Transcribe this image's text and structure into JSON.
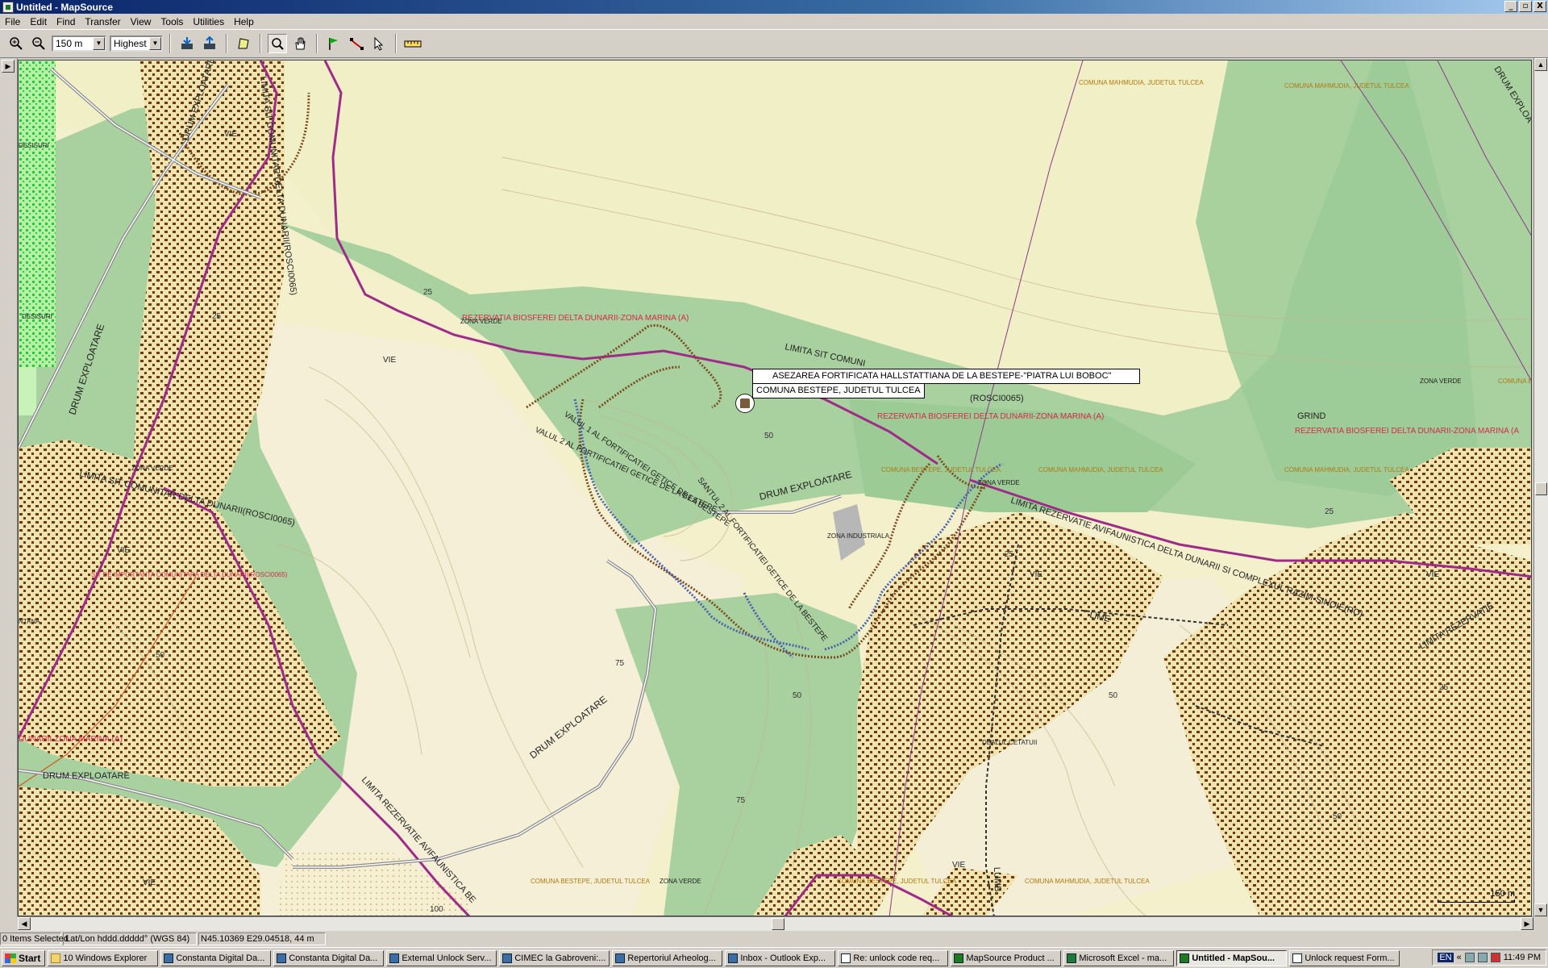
{
  "window": {
    "title": "Untitled - MapSource",
    "buttons": [
      "_",
      "▫",
      "X"
    ]
  },
  "menu": [
    "File",
    "Edit",
    "Find",
    "Transfer",
    "View",
    "Tools",
    "Utilities",
    "Help"
  ],
  "toolbar": {
    "zoom_value": "150 m",
    "detail_value": "Highest"
  },
  "map": {
    "tooltip_title": "ASEZAREA FORTIFICATA HALLSTATTIANA DE LA BESTEPE-\"PIATRA LUI BOBOC\"",
    "tooltip_subtitle": "COMUNA BESTEPE, JUDETUL TULCEA",
    "labels": {
      "rez1": "REZERVATIA BIOSFEREI DELTA DUNARII-ZONA MARINA (A)",
      "rez2": "REZERVATIA BIOSFEREI DELTA DUNARII-ZONA MARINA (A)",
      "rez3": "REZERVATIA BIOSFEREI DELTA DUNARII-ZONA MARINA (A",
      "rez4": "DUNARII-ZONA MARINA (A)",
      "mahm1": "COMUNA MAHMUDIA, JUDETUL TULCEA",
      "mahm2": "COMUNA MAHMUDIA, JUDETUL TULCEA",
      "mahm3": "COMUNA MAHMUDIA, JUDETUL TULCEA",
      "mahm4": "COMUNA MAHMUDIA, JUDETUL TULCEA",
      "mahm5": "COMUNA MAHMUDIA, JUDETUL TULCEA",
      "bestepe1": "COMUNA BESTEPE, JUDETUL TULCEA",
      "bestepe2": "COMUNA BESTEPE, JUDETUL TULCEA",
      "bestepe3": "COMUNA BESTEPE, JUDETUL TULCEA",
      "zona_be": "COMUNA BE",
      "drum1": "DRUM EXPLOATARE",
      "drum2": "DRUM EXPLOATARE",
      "drum3": "DRUM EXPLOATARE",
      "drum4": "DRUM EXPLOATARE",
      "drum5": "DRUM EXPLOA",
      "drum6": "DRUM EXPLOATARE",
      "zv1": "ZONA VERDE",
      "zv2": "ZONA VERDE",
      "zv3": "ZONA VERDE",
      "zv4": "ZONA VERDE",
      "zv5": "ZONA VERDE",
      "zi": "ZONA INDUSTRIALA",
      "grind": "GRIND",
      "vie1": "VIE",
      "vie2": "VIE",
      "vie3": "VIE",
      "vie4": "VIE",
      "vie5": "VIE",
      "vie6": "VIE",
      "vie7": "VIE",
      "desisuri1": "DESISURI",
      "desisuri2": "DESISURI",
      "ntana": "NTANA",
      "limita_sit1": "LIMITA SIT COMUNITAR DELTA DUNARII(ROSCI0065)",
      "limita_sit2": "LIMITA SIT COMUNITAR DELTA DUNARII(ROSCI0065)",
      "limita_sit3": "LIMITA SIT COMUNI",
      "rosci": "(ROSCI0065)",
      "situl": "SIT DE IMPORTANTA COMUNITARA DELTA DUNARII(ROSCI0065)",
      "valul1": "VALUL 2 AL FORTIFICATIEI GETICE DE LA BESTEPE",
      "valul2": "VALUL 1 AL FORTIFICATIEI GETICE DE LA BESTEPE",
      "santul": "SANTUL 2 AL FORTIFICATIEI GETICE DE LA BESTEPE",
      "limita_rez1": "LIMITA REZERVATIE AVIFAUNISTICA DELTA DUNARII SI COMPLEXUL RAZIM-SINOIE(RO)",
      "limita_rez2": "LIMITA REZERVATIE AVIFAUNISTICA BE",
      "limita_rez3": "LIMITA REZERVATIE",
      "dealul": "DEALUL CETATUII",
      "lime": "LIME",
      "lumb": "LUMB",
      "c25a": "25",
      "c25b": "25",
      "c25c": "25",
      "c25d": "25",
      "c25e": "25",
      "c50a": "50",
      "c50b": "50",
      "c50c": "50",
      "c50d": "50",
      "c50e": "50",
      "c75a": "75",
      "c75b": "75",
      "c100": "100"
    },
    "scale": "150 m"
  },
  "status": {
    "selected": "0 Items Selected",
    "format": "Lat/Lon hddd.ddddd° (WGS 84)",
    "position": "N45.10369 E29.04518, 44 m"
  },
  "taskbar": {
    "start": "Start",
    "tasks": [
      "10 Windows Explorer",
      "Constanta Digital Da...",
      "Constanta Digital Da...",
      "External Unlock Serv...",
      "CIMEC la Gabroveni:...",
      "Repertoriul Arheolog...",
      "Inbox - Outlook Exp...",
      "Re: unlock code req...",
      "MapSource Product ...",
      "Microsoft Excel - ma...",
      "Untitled - MapSou...",
      "Unlock request Form..."
    ],
    "lang": "EN",
    "time": "11:49 PM"
  }
}
